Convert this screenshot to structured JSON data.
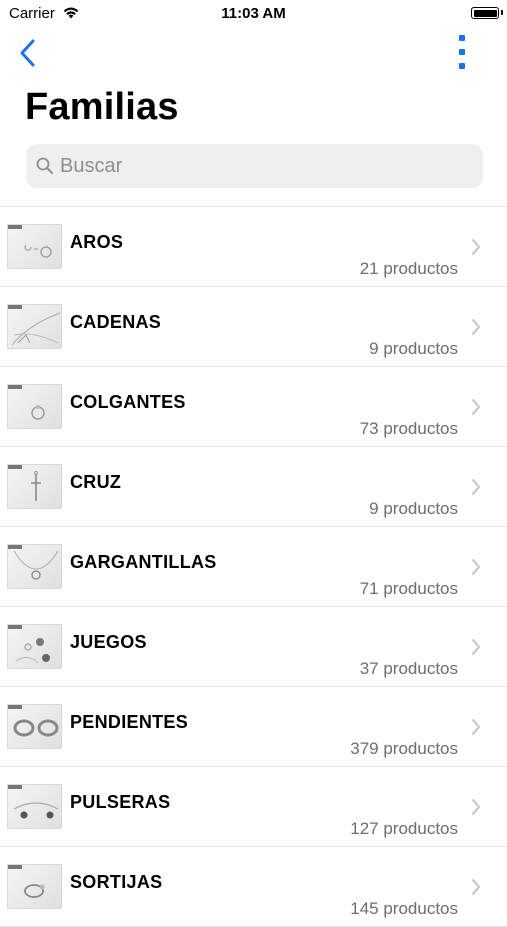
{
  "status_bar": {
    "carrier": "Carrier",
    "time": "11:03 AM"
  },
  "nav": {
    "title": "Familias"
  },
  "search": {
    "placeholder": "Buscar"
  },
  "families": [
    {
      "name": "AROS",
      "count": "21 productos",
      "thumb": "earrings-hoops"
    },
    {
      "name": "CADENAS",
      "count": "9 productos",
      "thumb": "chains"
    },
    {
      "name": "COLGANTES",
      "count": "73 productos",
      "thumb": "pendant"
    },
    {
      "name": "CRUZ",
      "count": "9 productos",
      "thumb": "cross"
    },
    {
      "name": "GARGANTILLAS",
      "count": "71 productos",
      "thumb": "necklace"
    },
    {
      "name": "JUEGOS",
      "count": "37 productos",
      "thumb": "jewelry-set"
    },
    {
      "name": "PENDIENTES",
      "count": "379 productos",
      "thumb": "hoop-earrings"
    },
    {
      "name": "PULSERAS",
      "count": "127 productos",
      "thumb": "bracelet"
    },
    {
      "name": "SORTIJAS",
      "count": "145 productos",
      "thumb": "ring"
    }
  ],
  "colors": {
    "accent": "#1a73e8",
    "separator": "#e2e2e6",
    "search_bg": "#efeff0",
    "secondary_text": "#6d6d72"
  }
}
